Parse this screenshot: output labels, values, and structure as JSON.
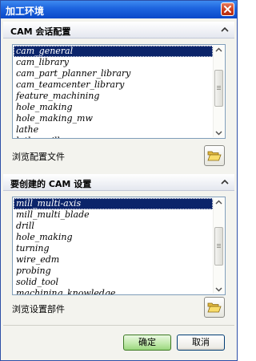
{
  "window": {
    "title": "加工环境"
  },
  "session_section": {
    "title": "CAM 会话配置",
    "items": [
      {
        "label": "cam_general",
        "selected": true
      },
      {
        "label": "cam_library"
      },
      {
        "label": "cam_part_planner_library"
      },
      {
        "label": "cam_teamcenter_library"
      },
      {
        "label": "feature_machining"
      },
      {
        "label": "hole_making"
      },
      {
        "label": "hole_making_mw"
      },
      {
        "label": "lathe"
      },
      {
        "label": "lathe_mill"
      }
    ],
    "browse_label": "浏览配置文件"
  },
  "setup_section": {
    "title": "要创建的 CAM 设置",
    "items": [
      {
        "label": "mill_multi-axis",
        "selected": true
      },
      {
        "label": "mill_multi_blade"
      },
      {
        "label": "drill"
      },
      {
        "label": "hole_making"
      },
      {
        "label": "turning"
      },
      {
        "label": "wire_edm"
      },
      {
        "label": "probing"
      },
      {
        "label": "solid_tool"
      },
      {
        "label": "machining_knowledge"
      }
    ],
    "browse_label": "浏览设置部件"
  },
  "buttons": {
    "ok_label": "确定",
    "cancel_label": "取消"
  },
  "icons": {
    "close": "close-icon",
    "collapse": "chevron-up-icon",
    "folder": "open-folder-icon",
    "scroll_up": "scroll-up-arrow-icon",
    "scroll_down": "scroll-down-arrow-icon"
  },
  "colors": {
    "titlebar": "#0a49c9",
    "selection": "#0b246a",
    "ok_button": "#9ad67e"
  }
}
